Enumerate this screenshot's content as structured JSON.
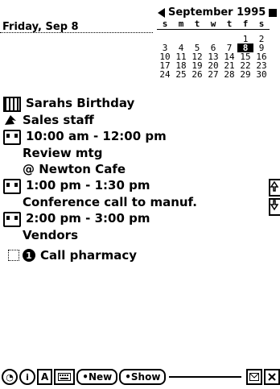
{
  "header": {
    "date_label": "Friday, Sep 8",
    "month_label": "September 1995"
  },
  "calendar": {
    "weekday_headers": [
      "s",
      "m",
      "t",
      "w",
      "t",
      "f",
      "s"
    ],
    "rows": [
      [
        "",
        "",
        "",
        "",
        "",
        "1",
        "2"
      ],
      [
        "3",
        "4",
        "5",
        "6",
        "7",
        "8",
        "9"
      ],
      [
        "10",
        "11",
        "12",
        "13",
        "14",
        "15",
        "16"
      ],
      [
        "17",
        "18",
        "19",
        "20",
        "21",
        "22",
        "23"
      ],
      [
        "24",
        "25",
        "26",
        "27",
        "28",
        "29",
        "30"
      ]
    ],
    "selected_day": "8"
  },
  "agenda": {
    "birthday": "Sarahs Birthday",
    "staff": "Sales staff",
    "meeting1_time": "10:00 am - 12:00 pm",
    "meeting1_title": "Review mtg",
    "meeting1_location": "@ Newton Cafe",
    "meeting2_time": "1:00 pm - 1:30 pm",
    "meeting2_title": "Conference call to manuf.",
    "meeting3_time": "2:00 pm - 3:00 pm",
    "meeting3_title": "Vendors",
    "todo": "Call pharmacy",
    "todo_priority": "1"
  },
  "toolbar": {
    "clock_glyph": "◔",
    "info_label": "i",
    "a_label": "A",
    "new_label": "•New",
    "show_label": "•Show"
  }
}
